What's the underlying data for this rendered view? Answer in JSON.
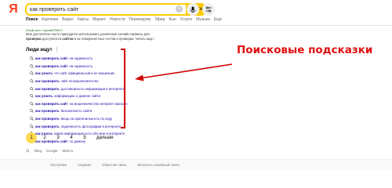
{
  "header": {
    "logo": "Я",
    "search_value": "как проверить сайт",
    "find_label": "Найти"
  },
  "tabs": [
    "Поиск",
    "Картинки",
    "Видео",
    "Карты",
    "Маркет",
    "Новости",
    "Переводчик",
    "Эфир",
    "Кью",
    "Услуги",
    "Музыка",
    "Ещё"
  ],
  "prev_result": {
    "url": "it-hub.com › is/post/79517/",
    "line1": "Мне достаточно часто приходится использовать различные онлайн-сервисы для",
    "line2_bold1": "проверки",
    "line2_mid": " доступности ",
    "line2_bold2": "сайтов",
    "line2_end": " и их поверхностных тестов и проверки. Читать ещё ›"
  },
  "people_ask": {
    "title": "Люди ищут",
    "dots": "⋮",
    "items": [
      {
        "q": "как проверить сайт",
        "rest": " на надежность"
      },
      {
        "q": "как проверить сайт",
        "rest": " на надежность"
      },
      {
        "q": "как узнать",
        "rest": " что сайт официальный и не мошенник"
      },
      {
        "q": "как проверить",
        "rest": " сайт на мошенничество"
      },
      {
        "q": "как проверить",
        "rest": " достоверность информации в интернете"
      },
      {
        "q": "как узнать",
        "rest": " информацию о домене сайта"
      },
      {
        "q": "как проверить сайт",
        "rest": " на мошенничество интернет магазин"
      },
      {
        "q": "как проверить",
        "rest": " безопасность сайта"
      },
      {
        "q": "как проверить",
        "rest": " вещь на оригинальность по коду"
      },
      {
        "q": "как проверить",
        "rest": " подлинность фотографии в интернете"
      },
      {
        "q": "как узнать",
        "rest": " какая информация есть обо мне в интернете"
      },
      {
        "q": "как проверить сайт",
        "rest": " по домену"
      }
    ]
  },
  "annotation": "Поисковые подсказки",
  "pagination": {
    "pages": [
      "1",
      "2",
      "3",
      "4",
      "5"
    ],
    "next": "дальше"
  },
  "footer_links": [
    "Blog",
    "Google",
    "Mail.ru"
  ],
  "footer_bottom": [
    "Настройки",
    "Справка",
    "Обратная связь",
    "Включить семейный поиск"
  ],
  "colors": {
    "accent": "#ffcc00",
    "link": "#1a0dab",
    "annotation": "#e01010",
    "logo": "#fc3f1d"
  }
}
